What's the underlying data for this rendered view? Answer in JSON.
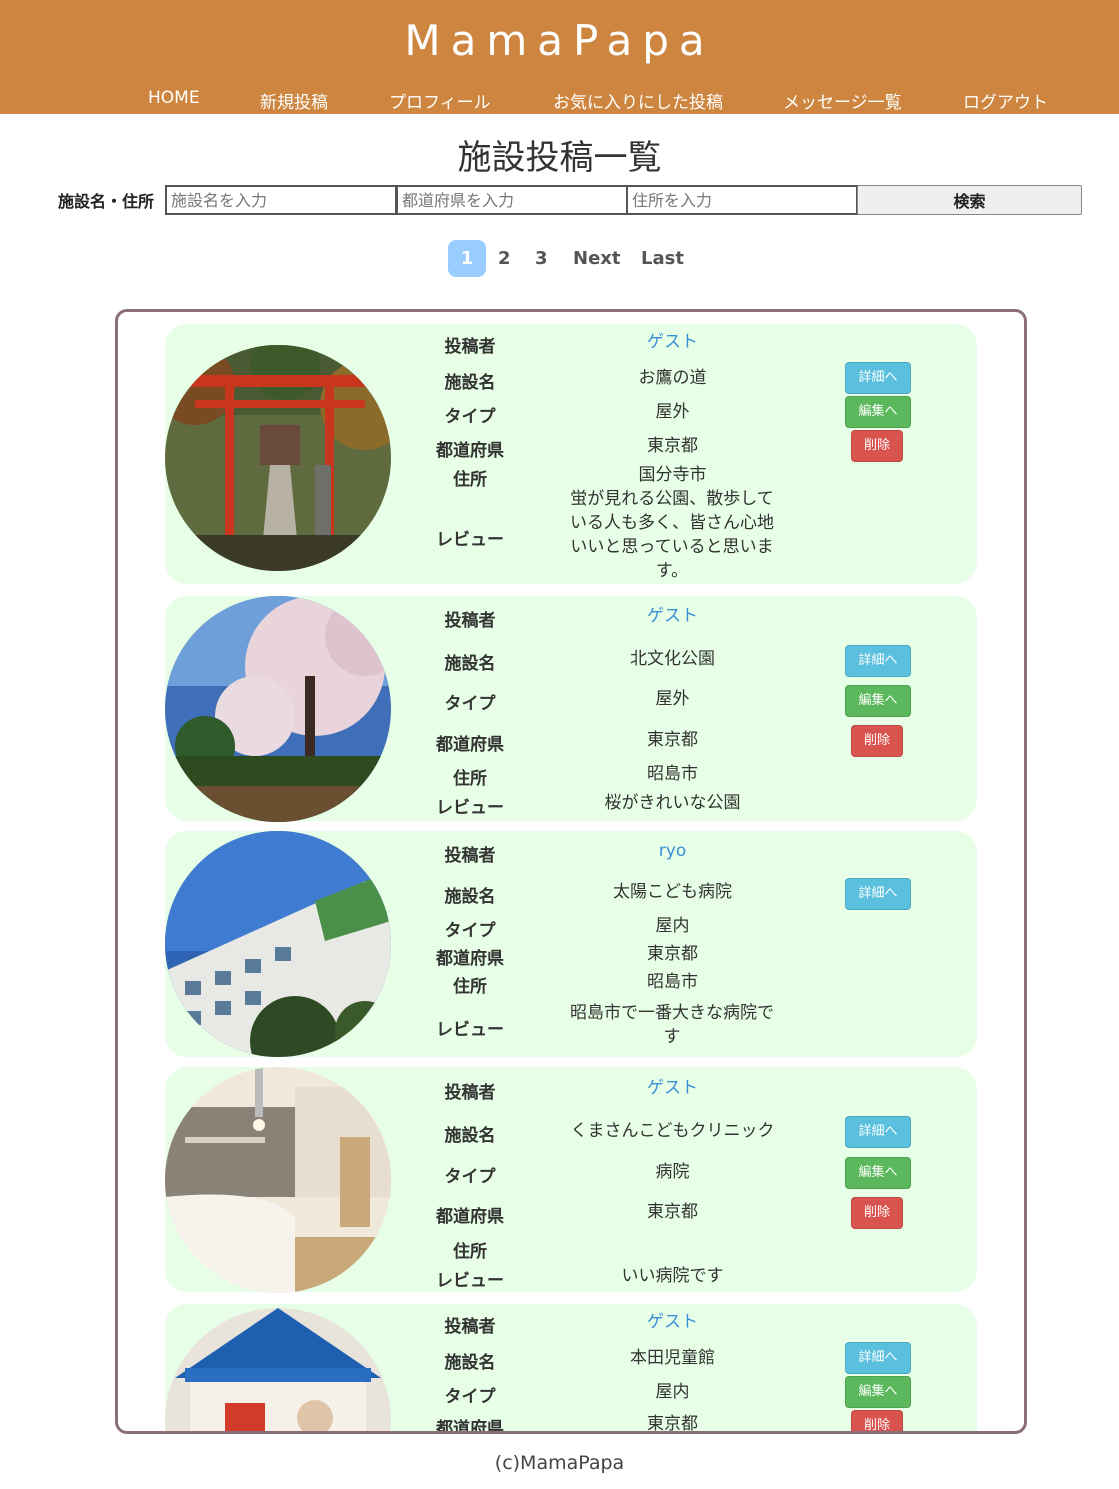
{
  "header": {
    "brand": "MamaPapa",
    "nav": [
      "HOME",
      "新規投稿",
      "プロフィール",
      "お気に入りにした投稿",
      "メッセージ一覧",
      "ログアウト"
    ]
  },
  "page_title": "施設投稿一覧",
  "search": {
    "label": "施設名・住所",
    "name_placeholder": "施設名を入力",
    "pref_placeholder": "都道府県を入力",
    "address_placeholder": "住所を入力",
    "button": "検索"
  },
  "pagination": {
    "current": "1",
    "pages": [
      "2",
      "3"
    ],
    "next": "Next",
    "last": "Last"
  },
  "labels": {
    "poster": "投稿者",
    "name": "施設名",
    "type": "タイプ",
    "prefecture": "都道府県",
    "address": "住所",
    "review": "レビュー"
  },
  "buttons": {
    "detail": "詳細へ",
    "edit": "編集へ",
    "delete": "削除"
  },
  "posts": [
    {
      "poster": "ゲスト",
      "name": "お鷹の道",
      "type": "屋外",
      "prefecture": "東京都",
      "address": "国分寺市",
      "review": "蛍が見れる公園、散歩している人も多く、皆さん心地いいと思っていると思います。",
      "image": "shrine-torii-photo"
    },
    {
      "poster": "ゲスト",
      "name": "北文化公園",
      "type": "屋外",
      "prefecture": "東京都",
      "address": "昭島市",
      "review": "桜がきれいな公園",
      "image": "cherry-blossom-park-photo"
    },
    {
      "poster": "ryo",
      "name": "太陽こども病院",
      "type": "屋内",
      "prefecture": "東京都",
      "address": "昭島市",
      "review": "昭島市で一番大きな病院です",
      "image": "hospital-building-photo"
    },
    {
      "poster": "ゲスト",
      "name": "くまさんこどもクリニック",
      "type": "病院",
      "prefecture": "東京都",
      "address": "",
      "review": "いい病院です",
      "image": "clinic-reception-photo"
    },
    {
      "poster": "ゲスト",
      "name": "本田児童館",
      "type": "屋内",
      "prefecture": "東京都",
      "address": "",
      "review": "",
      "image": "playhouse-photo"
    }
  ],
  "footer": "(c)MamaPapa"
}
